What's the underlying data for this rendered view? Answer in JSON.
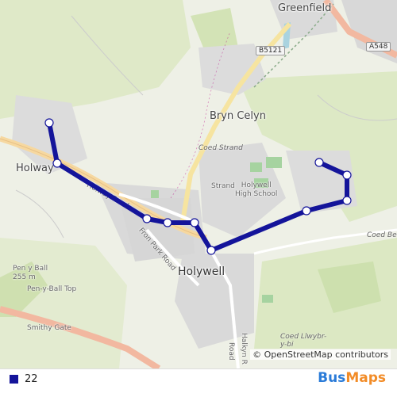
{
  "map": {
    "places": {
      "greenfield": "Greenfield",
      "bryn_celyn": "Bryn Celyn",
      "holway": "Holway",
      "holywell": "Holywell",
      "strand": "Strand",
      "coed_strand": "Coed Strand",
      "holywell_high_school": "Holywell\nHigh School",
      "pen_y_ball": "Pen y Ball\n255 m",
      "pen_y_ball_top": "Pen-y-Ball Top",
      "smithy_gate": "Smithy Gate",
      "coed_llwybr": "Coed Llwybr-\ny-bi"
    },
    "roads": {
      "b5121": "B5121",
      "a548": "A548",
      "holway_road": "Holway Road",
      "fron_park_road": "Fron Park Road",
      "coed_bell": "Coed Be",
      "halkyn_road": "Halkyn R",
      "road_bottom": "Road"
    },
    "attribution": "© OpenStreetMap contributors"
  },
  "route": {
    "color": "#14149a",
    "stop_count": 10
  },
  "legend": {
    "route_number": "22",
    "route_color": "#14149a"
  },
  "brand": {
    "part1": "Bus",
    "part2": "Maps"
  }
}
